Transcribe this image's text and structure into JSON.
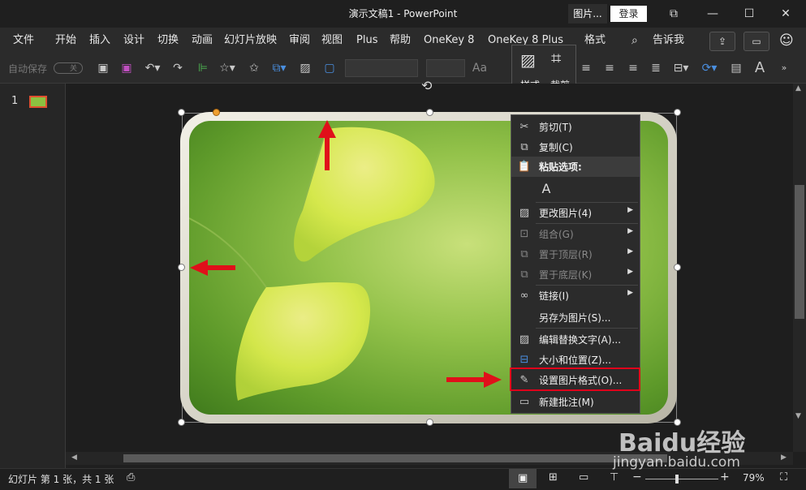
{
  "titlebar": {
    "title": "演示文稿1  -  PowerPoint",
    "picture_tools": "图片...",
    "login": "登录"
  },
  "menu": {
    "items": [
      "文件",
      "开始",
      "插入",
      "设计",
      "切换",
      "动画",
      "幻灯片放映",
      "审阅",
      "视图",
      "Plus",
      "帮助",
      "OneKey 8",
      "OneKey 8 Plus",
      "格式"
    ],
    "tell_me": "告诉我"
  },
  "toolbar": {
    "autosave": "自动保存",
    "autosave_state": "关",
    "font_size_label": "Aa"
  },
  "minibar": {
    "style_label": "样式",
    "crop_label": "裁剪"
  },
  "slides": {
    "number": "1"
  },
  "context_menu": {
    "cut": "剪切(T)",
    "copy": "复制(C)",
    "paste_options": "粘贴选项:",
    "change_picture": "更改图片(4)",
    "group": "组合(G)",
    "bring_front": "置于顶层(R)",
    "send_back": "置于底层(K)",
    "link": "链接(I)",
    "save_as_picture": "另存为图片(S)...",
    "edit_alt_text": "编辑替换文字(A)...",
    "size_position": "大小和位置(Z)...",
    "format_picture": "设置图片格式(O)...",
    "new_comment": "新建批注(M)"
  },
  "status": {
    "slide_info": "幻灯片 第 1 张，共 1 张",
    "zoom": "79%"
  },
  "watermark": {
    "brand": "Baidu经验",
    "url": "jingyan.baidu.com"
  },
  "colors": {
    "highlight_red": "#e0001a",
    "accent_green": "#8cc040"
  }
}
